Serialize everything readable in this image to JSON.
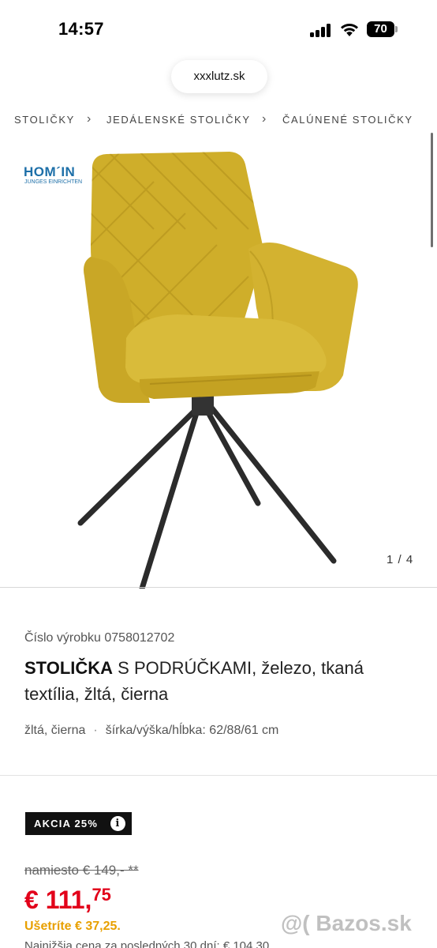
{
  "status_bar": {
    "time": "14:57",
    "battery": "70",
    "icons": [
      "signal-icon",
      "wifi-icon",
      "battery-icon"
    ]
  },
  "browser": {
    "url": "xxxlutz.sk"
  },
  "breadcrumb": {
    "items": [
      "STOLIČKY",
      "JEDÁLENSKÉ STOLIČKY",
      "ČALÚNENÉ STOLIČKY"
    ],
    "separator_icon": "chevron-right-icon"
  },
  "gallery": {
    "brand_name": "HOM´IN",
    "brand_tagline": "JUNGES EINRICHTEN",
    "image_counter": "1 / 4"
  },
  "product": {
    "number": "Číslo výrobku 0758012702",
    "title_bold": "STOLIČKA",
    "title_rest": " S PODRÚČKAMI, železo, tkaná textília, žltá, čierna",
    "color": "žltá, čierna",
    "dimensions": "šírka/výška/hĺbka: 62/88/61 cm"
  },
  "sale": {
    "badge": "AKCIA 25%",
    "info_icon": "i",
    "old_price": "namiesto € 149,- **",
    "new_price_main": "€ 111,",
    "new_price_cents": "75",
    "savings": "Ušetríte € 37,25.",
    "lowest_price": "Najnižšia cena za posledných 30 dní: € 104,30"
  },
  "watermark": {
    "text": "@( Bazos.sk"
  },
  "colors": {
    "price_red": "#e2001a",
    "savings_yellow": "#e8a000",
    "brand_blue": "#1d6fa8",
    "chair_yellow": "#d4b733"
  }
}
